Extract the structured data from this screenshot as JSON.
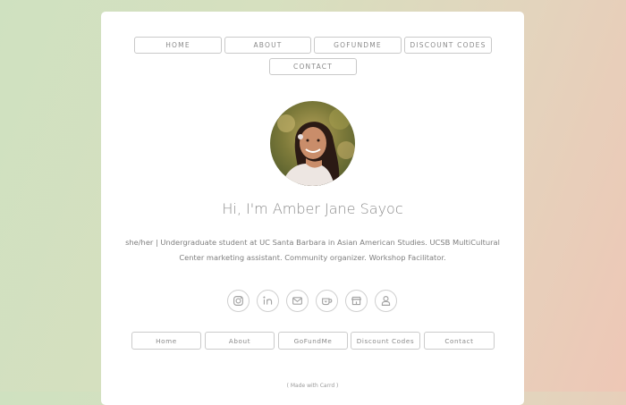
{
  "nav": {
    "items": [
      {
        "label": "HOME"
      },
      {
        "label": "ABOUT"
      },
      {
        "label": "GOFUNDME"
      },
      {
        "label": "DISCOUNT CODES"
      },
      {
        "label": "CONTACT"
      }
    ]
  },
  "profile": {
    "name_heading": "Hi, I'm Amber Jane Sayoc",
    "bio": "she/her | Undergraduate student at UC Santa Barbara in Asian American Studies. UCSB MultiCultural Center marketing assistant. Community organizer. Workshop Facilitator."
  },
  "social_icons": [
    "instagram-icon",
    "linkedin-icon",
    "email-icon",
    "coffee-icon",
    "store-icon",
    "user-icon"
  ],
  "footer_buttons": [
    {
      "label": "Home"
    },
    {
      "label": "About"
    },
    {
      "label": "GoFundMe"
    },
    {
      "label": "Discount Codes"
    },
    {
      "label": "Contact"
    }
  ],
  "credit": "( Made with Carrd )",
  "colors": {
    "text": "#8a8a8a",
    "border": "#c9c9c9",
    "card": "#ffffff"
  }
}
